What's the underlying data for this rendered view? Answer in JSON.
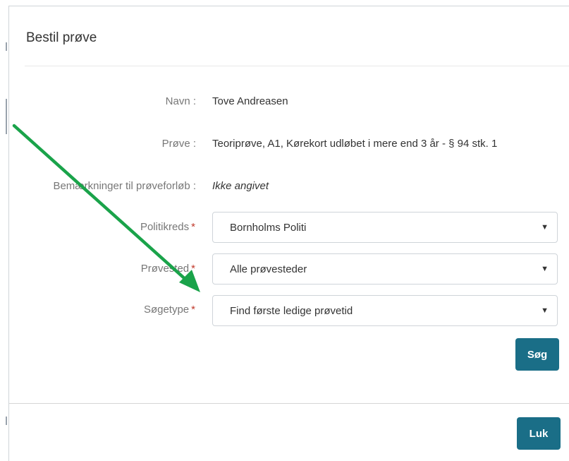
{
  "modal": {
    "title": "Bestil prøve"
  },
  "details": {
    "name_label": "Navn :",
    "name_value": "Tove Andreasen",
    "test_label": "Prøve :",
    "test_value": "Teoriprøve, A1, Kørekort udløbet i mere end 3 år - § 94 stk. 1",
    "remarks_label": "Bemærkninger til prøveforløb :",
    "remarks_value": "Ikke angivet"
  },
  "form": {
    "required_mark": "*",
    "police_district_label": "Politikreds",
    "police_district_value": "Bornholms Politi",
    "test_site_label": "Prøvested",
    "test_site_value": "Alle prøvesteder",
    "search_type_label": "Søgetype",
    "search_type_value": "Find første ledige prøvetid"
  },
  "buttons": {
    "search": "Søg",
    "close": "Luk"
  },
  "icons": {
    "dropdown": "caret-down-icon",
    "annotation": "green-arrow-icon"
  },
  "colors": {
    "primary_button": "#1a6e87",
    "required": "#c0392b",
    "annotation_arrow": "#1aa34a"
  }
}
